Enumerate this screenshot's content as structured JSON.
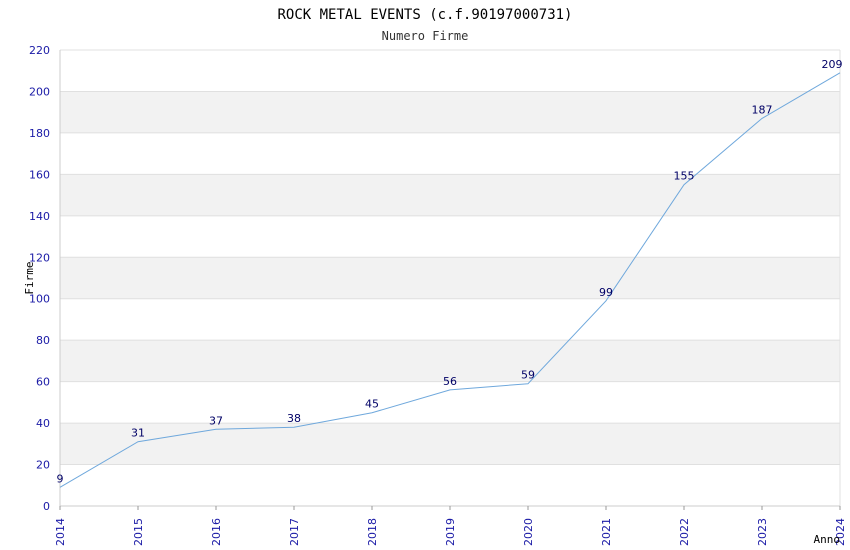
{
  "chart_data": {
    "type": "line",
    "title": "ROCK METAL EVENTS (c.f.90197000731)",
    "subtitle": "Numero Firme",
    "xlabel": "Anno",
    "ylabel": "Firme",
    "x": [
      "2014",
      "2015",
      "2016",
      "2017",
      "2018",
      "2019",
      "2020",
      "2021",
      "2022",
      "2023",
      "2024"
    ],
    "values": [
      9,
      31,
      37,
      38,
      45,
      56,
      59,
      99,
      155,
      187,
      209
    ],
    "ylim": [
      0,
      220
    ],
    "yticks": [
      0,
      20,
      40,
      60,
      80,
      100,
      120,
      140,
      160,
      180,
      200,
      220
    ],
    "grid": true,
    "colors": {
      "line": "#6fa8dc",
      "band": "#f2f2f2",
      "tick_text": "#1a1aa6",
      "data_label": "#000066"
    }
  }
}
